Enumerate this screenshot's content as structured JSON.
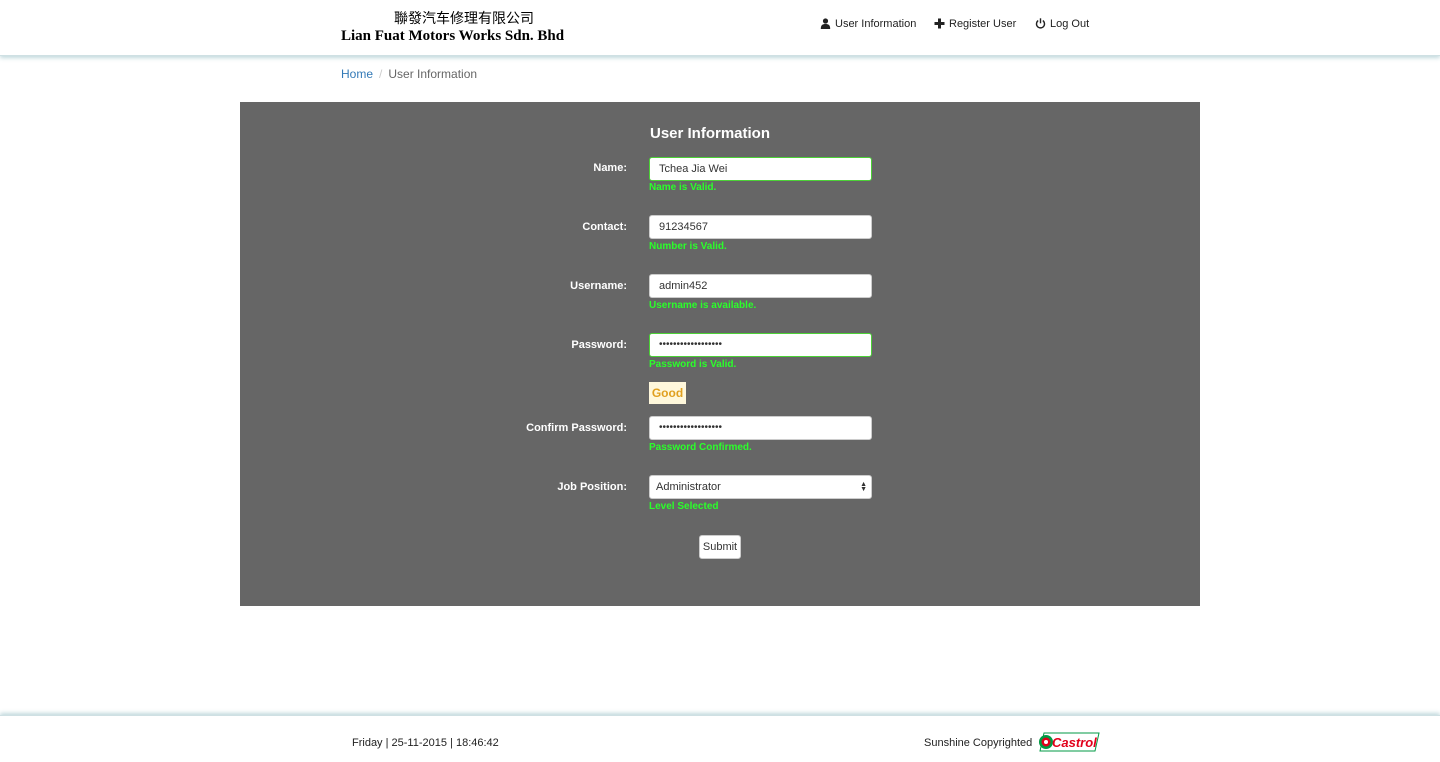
{
  "header": {
    "brand_cn": "聯發汽车修理有限公司",
    "brand_en": "Lian Fuat Motors Works Sdn. Bhd",
    "nav": [
      {
        "label": "User Information",
        "icon": "user-icon"
      },
      {
        "label": "Register User",
        "icon": "plus-icon"
      },
      {
        "label": "Log Out",
        "icon": "power-icon"
      }
    ]
  },
  "breadcrumb": {
    "home": "Home",
    "separator": "/",
    "current": "User Information"
  },
  "form": {
    "title": "User Information",
    "fields": [
      {
        "label": "Name:",
        "value": "Tchea Jia Wei",
        "message": "Name is Valid."
      },
      {
        "label": "Contact:",
        "value": "91234567",
        "message": "Number is Valid."
      },
      {
        "label": "Username:",
        "value": "admin452",
        "message": "Username is available."
      },
      {
        "label": "Password:",
        "value": "••••••••••••••••••",
        "message": "Password is Valid."
      },
      {
        "label": "Confirm Password:",
        "value": "••••••••••••••••••",
        "message": "Password Confirmed."
      },
      {
        "label": "Job Position:",
        "value": "Administrator",
        "message": "Level Selected"
      }
    ],
    "password_strength": "Good",
    "submit_label": "Submit"
  },
  "footer": {
    "datetime": "Friday | 25-11-2015 | 18:46:42",
    "copyright": "Sunshine Copyrighted",
    "logo_text": "Castrol"
  },
  "colors": {
    "panel_bg": "#666666",
    "valid_text": "#2aff2a",
    "link": "#337ab7",
    "strength_text": "#e0a020",
    "castrol_green": "#009a44",
    "castrol_red": "#e2001a"
  }
}
